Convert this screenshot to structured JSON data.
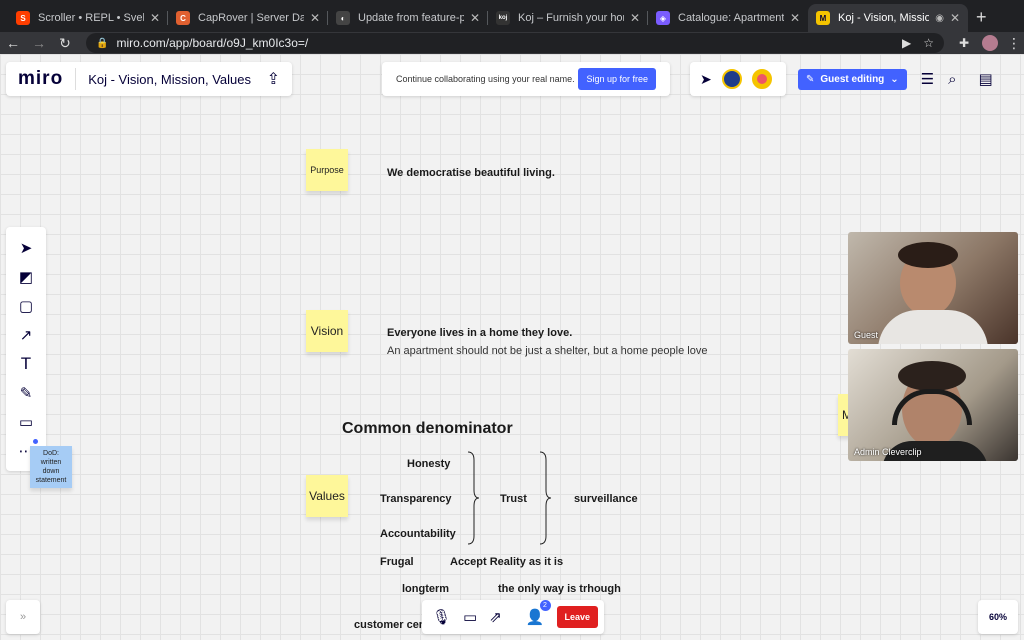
{
  "browser": {
    "tabs": [
      {
        "title": "Scroller • REPL • Svelte",
        "favicon_color": "#ff3e00",
        "favicon_glyph": "S"
      },
      {
        "title": "CapRover | Server Dashboard",
        "favicon_color": "#e06030",
        "favicon_glyph": "C"
      },
      {
        "title": "Update from feature-propos",
        "favicon_color": "#444",
        "favicon_glyph": "◐"
      },
      {
        "title": "Koj – Furnish your home in s",
        "favicon_color": "#333",
        "favicon_glyph": "koj"
      },
      {
        "title": "Catalogue: Apartments - Air",
        "favicon_color": "#7a5cff",
        "favicon_glyph": "◈"
      },
      {
        "title": "Koj - Vision, Mission, Va",
        "favicon_color": "#f5c400",
        "favicon_glyph": "M"
      }
    ],
    "url": "miro.com/app/board/o9J_km0Ic3o=/"
  },
  "header": {
    "logo": "miro",
    "board_title": "Koj - Vision, Mission, Values",
    "collab_message": "Continue collaborating using your real name.",
    "signup_label": "Sign up for free",
    "guest_label": "Guest editing"
  },
  "board": {
    "purpose_label": "Purpose",
    "purpose_text": "We democratise beautiful living.",
    "vision_label": "Vision",
    "vision_title": "Everyone lives in a home they love.",
    "vision_sub": "An apartment should not be just a shelter, but a home people love",
    "common_heading": "Common denominator",
    "honesty": "Honesty",
    "transparency": "Transparency",
    "accountability": "Accountability",
    "trust": "Trust",
    "surveillance": "surveillance",
    "values_label": "Values",
    "frugal": "Frugal",
    "accept_reality": "Accept Reality as it is",
    "longterm": "longterm",
    "only_way": "the only way is trhough",
    "customer": "customer cen",
    "dod_note": "DoD: written down statement",
    "right_sticky_letter": "M"
  },
  "video": {
    "tile1_name": "Guest",
    "tile2_name": "Admin Cleverclip"
  },
  "bottom": {
    "participants_count": "2",
    "leave_label": "Leave",
    "zoom": "60%"
  }
}
